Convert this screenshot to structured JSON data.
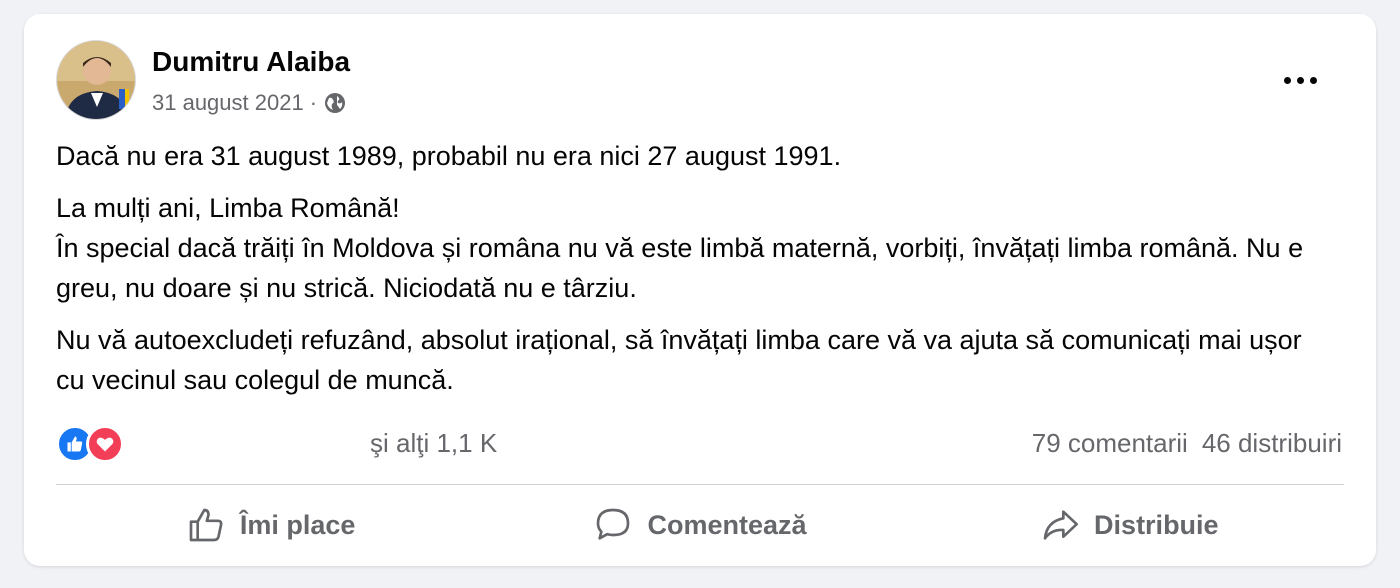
{
  "post": {
    "author": "Dumitru Alaiba",
    "date": "31 august 2021",
    "separator": "·",
    "paragraphs": [
      "Dacă nu era 31 august 1989, probabil nu era nici 27 august 1991.",
      "La mulți ani, Limba Română!\nÎn special dacă trăiți în Moldova și româna nu vă este limbă maternă, vorbiți, învățați limba română. Nu e greu, nu doare și nu strică. Niciodată nu e târziu.",
      "Nu vă autoexcludeți refuzând, absolut irațional, să învățați limba care vă va ajuta să comunicați mai ușor cu vecinul sau colegul de muncă."
    ]
  },
  "stats": {
    "reactions_text": "şi alţi 1,1 K",
    "comments": "79 comentarii",
    "shares": "46 distribuiri"
  },
  "actions": {
    "like": "Îmi place",
    "comment": "Comentează",
    "share": "Distribuie"
  },
  "icons": [
    "globe-icon",
    "more-icon",
    "like-icon",
    "love-icon",
    "thumbs-up-icon",
    "comment-icon",
    "share-icon"
  ],
  "colors": {
    "like_blue": "#1877f2",
    "love_red": "#f33e58",
    "secondary_text": "#65676b"
  }
}
